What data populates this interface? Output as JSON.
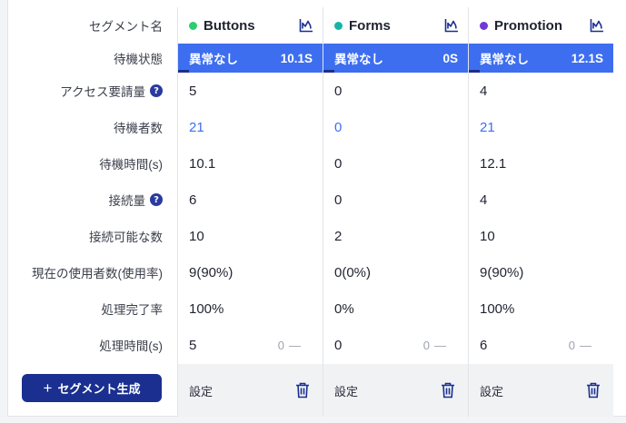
{
  "row_labels": [
    {
      "label": "セグメント名",
      "help": false
    },
    {
      "label": "待機状態",
      "help": false
    },
    {
      "label": "アクセス要請量",
      "help": true
    },
    {
      "label": "待機者数",
      "help": false
    },
    {
      "label": "待機時間(s)",
      "help": false
    },
    {
      "label": "接続量",
      "help": true
    },
    {
      "label": "接続可能な数",
      "help": false
    },
    {
      "label": "現在の使用者数(使用率)",
      "help": false
    },
    {
      "label": "処理完了率",
      "help": false
    },
    {
      "label": "処理時間(s)",
      "help": false
    }
  ],
  "help_glyph": "?",
  "add_button": {
    "plus": "+",
    "label": "セグメント生成"
  },
  "colors": {
    "accent": "#3d6ef0",
    "brand": "#1a2f8f",
    "green": "#2ecc71",
    "teal": "#19b3a6",
    "purple": "#6f3ad6"
  },
  "segments": [
    {
      "name": "Buttons",
      "dot_color": "#2ecc71",
      "status": "異常なし",
      "status_time": "10.1S",
      "access_requests": "5",
      "waiting": "21",
      "wait_time": "10.1",
      "connections": "6",
      "capacity": "10",
      "usage": "9(90%)",
      "completion": "100%",
      "proc_time": "5",
      "proc_extra": "0",
      "proc_dash": "—",
      "settings": "設定"
    },
    {
      "name": "Forms",
      "dot_color": "#19b3a6",
      "status": "異常なし",
      "status_time": "0S",
      "access_requests": "0",
      "waiting": "0",
      "wait_time": "0",
      "connections": "0",
      "capacity": "2",
      "usage": "0(0%)",
      "completion": "0%",
      "proc_time": "0",
      "proc_extra": "0",
      "proc_dash": "—",
      "settings": "設定"
    },
    {
      "name": "Promotion",
      "dot_color": "#6f3ad6",
      "status": "異常なし",
      "status_time": "12.1S",
      "access_requests": "4",
      "waiting": "21",
      "wait_time": "12.1",
      "connections": "4",
      "capacity": "10",
      "usage": "9(90%)",
      "completion": "100%",
      "proc_time": "6",
      "proc_extra": "0",
      "proc_dash": "—",
      "settings": "設定"
    }
  ]
}
